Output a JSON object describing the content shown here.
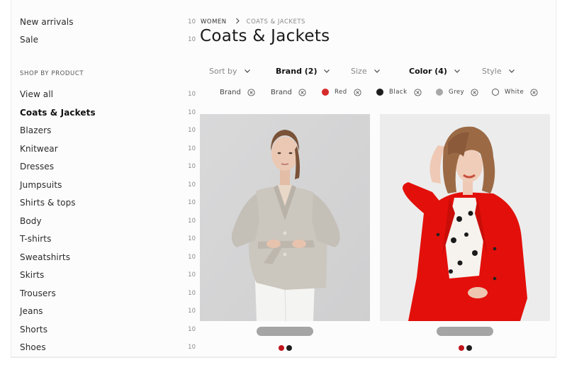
{
  "sidebar": {
    "top_items": [
      {
        "label": "New arrivals",
        "count": "10"
      },
      {
        "label": "Sale",
        "count": "10"
      }
    ],
    "section_heading": "SHOP BY PRODUCT",
    "items": [
      {
        "label": "View all",
        "count": "10",
        "active": false
      },
      {
        "label": "Coats & Jackets",
        "count": "10",
        "active": true
      },
      {
        "label": "Blazers",
        "count": "10",
        "active": false
      },
      {
        "label": "Knitwear",
        "count": "10",
        "active": false
      },
      {
        "label": "Dresses",
        "count": "10",
        "active": false
      },
      {
        "label": "Jumpsuits",
        "count": "10",
        "active": false
      },
      {
        "label": "Shirts & tops",
        "count": "10",
        "active": false
      },
      {
        "label": "Body",
        "count": "10",
        "active": false
      },
      {
        "label": "T-shirts",
        "count": "10",
        "active": false
      },
      {
        "label": "Sweatshirts",
        "count": "10",
        "active": false
      },
      {
        "label": "Skirts",
        "count": "10",
        "active": false
      },
      {
        "label": "Trousers",
        "count": "10",
        "active": false
      },
      {
        "label": "Jeans",
        "count": "10",
        "active": false
      },
      {
        "label": "Shorts",
        "count": "10",
        "active": false
      },
      {
        "label": "Shoes",
        "count": "10",
        "active": false
      }
    ]
  },
  "breadcrumb": {
    "parent": "WOMEN",
    "separator_icon": "chevron-right-icon",
    "current": "COATS & JACKETS"
  },
  "page_title": "Coats & Jackets",
  "filters": [
    {
      "label": "Sort by",
      "active": false,
      "icon": "chevron-down-icon"
    },
    {
      "label": "Brand (2)",
      "active": true,
      "icon": "chevron-down-icon"
    },
    {
      "label": "Size",
      "active": false,
      "icon": "chevron-down-icon"
    },
    {
      "label": "Color (4)",
      "active": true,
      "icon": "chevron-down-icon"
    },
    {
      "label": "Style",
      "active": false,
      "icon": "chevron-down-icon"
    }
  ],
  "active_chips": [
    {
      "label": "Brand",
      "swatch": null,
      "remove_icon": "circle-x-icon"
    },
    {
      "label": "Brand",
      "swatch": null,
      "remove_icon": "circle-x-icon"
    },
    {
      "label": "Red",
      "swatch": "#d62b2b",
      "remove_icon": "circle-x-icon"
    },
    {
      "label": "Black",
      "swatch": "#1e1e1e",
      "remove_icon": "circle-x-icon"
    },
    {
      "label": "Grey",
      "swatch": "#a8a8a8",
      "remove_icon": "circle-x-icon"
    },
    {
      "label": "White",
      "swatch": "#ffffff",
      "remove_icon": "circle-x-icon"
    }
  ],
  "products": [
    {
      "image_alt": "Woman in beige linen belted blazer and white trousers",
      "price_placeholder_color": "#a5a5a5",
      "color_options": [
        "#c0141c",
        "#1e1e1e"
      ]
    },
    {
      "image_alt": "Woman in red double-breasted coat over polka-dot blouse",
      "price_placeholder_color": "#a5a5a5",
      "color_options": [
        "#c0141c",
        "#1e1e1e"
      ]
    }
  ],
  "colors": {
    "accent_red": "#d62b2b",
    "text_dark": "#1a1a1a",
    "text_muted": "#888888"
  }
}
